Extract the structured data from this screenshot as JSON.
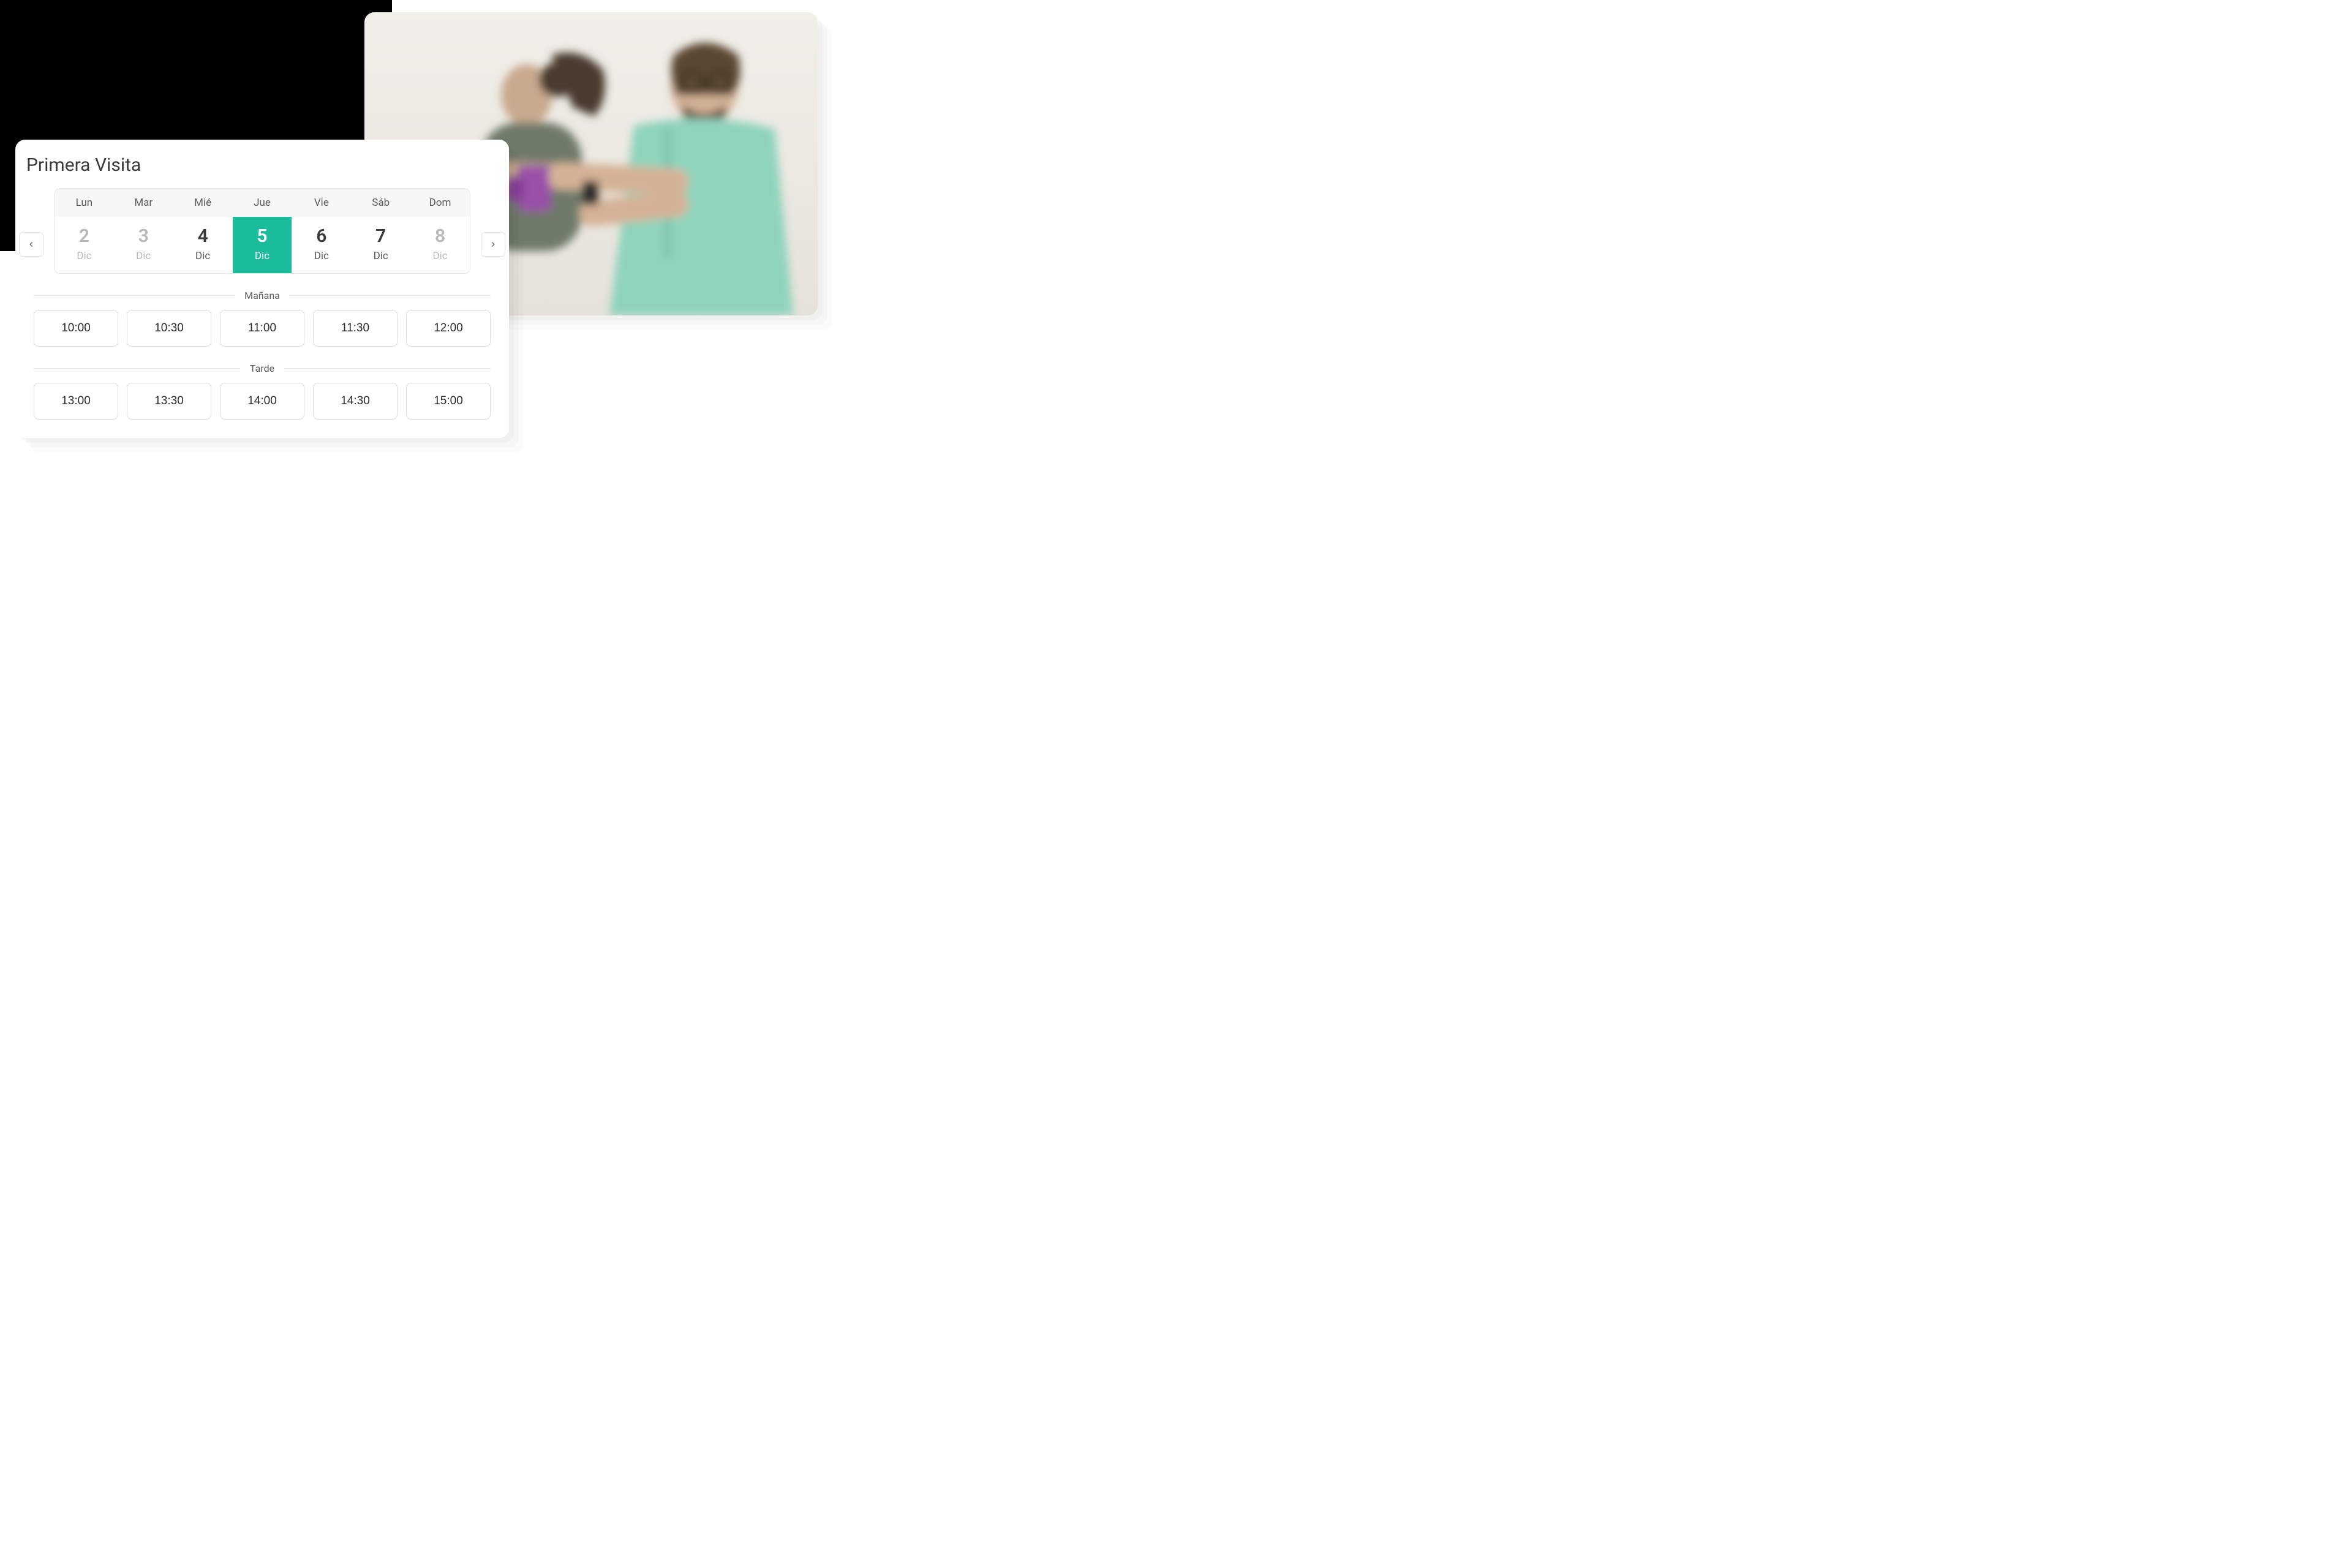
{
  "booking": {
    "title": "Primera Visita",
    "day_headers": [
      "Lun",
      "Mar",
      "Mié",
      "Jue",
      "Vie",
      "Sáb",
      "Dom"
    ],
    "days": [
      {
        "num": "2",
        "month": "Dic",
        "state": "disabled"
      },
      {
        "num": "3",
        "month": "Dic",
        "state": "disabled"
      },
      {
        "num": "4",
        "month": "Dic",
        "state": "normal"
      },
      {
        "num": "5",
        "month": "Dic",
        "state": "selected"
      },
      {
        "num": "6",
        "month": "Dic",
        "state": "normal"
      },
      {
        "num": "7",
        "month": "Dic",
        "state": "normal"
      },
      {
        "num": "8",
        "month": "Dic",
        "state": "disabled"
      }
    ],
    "sections": {
      "morning": {
        "label": "Mañana",
        "slots": [
          "10:00",
          "10:30",
          "11:00",
          "11:30",
          "12:00"
        ]
      },
      "afternoon": {
        "label": "Tarde",
        "slots": [
          "13:00",
          "13:30",
          "14:00",
          "14:30",
          "15:00"
        ]
      }
    }
  },
  "colors": {
    "accent": "#1abc9c"
  }
}
